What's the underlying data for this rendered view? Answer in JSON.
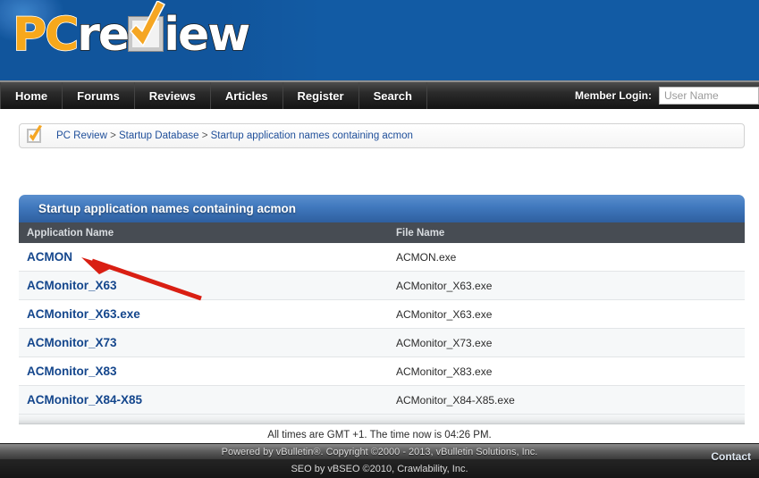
{
  "site": {
    "logo": {
      "part1": "PC",
      "part2": "re",
      "part3": "iew",
      "icon": "checkbox-check-icon"
    }
  },
  "nav": {
    "items": [
      {
        "label": "Home"
      },
      {
        "label": "Forums"
      },
      {
        "label": "Reviews"
      },
      {
        "label": "Articles"
      },
      {
        "label": "Register"
      },
      {
        "label": "Search"
      }
    ],
    "login_label": "Member Login:",
    "username_placeholder": "User Name",
    "username_value": ""
  },
  "breadcrumb": {
    "icon": "checkbox-check-icon",
    "root": "PC Review",
    "sep1": " > ",
    "level2": "Startup Database",
    "sep2": " > ",
    "current": "Startup application names containing acmon"
  },
  "panel": {
    "title": "Startup application names containing acmon",
    "columns": {
      "app": "Application Name",
      "file": "File Name"
    },
    "rows": [
      {
        "app": "ACMON",
        "file": "ACMON.exe"
      },
      {
        "app": "ACMonitor_X63",
        "file": "ACMonitor_X63.exe"
      },
      {
        "app": "ACMonitor_X63.exe",
        "file": "ACMonitor_X63.exe"
      },
      {
        "app": "ACMonitor_X73",
        "file": "ACMonitor_X73.exe"
      },
      {
        "app": "ACMonitor_X83",
        "file": "ACMonitor_X83.exe"
      },
      {
        "app": "ACMonitor_X84-X85",
        "file": "ACMonitor_X84-X85.exe"
      }
    ]
  },
  "annotation": {
    "type": "red-arrow",
    "color": "#d91f13",
    "points_to_row": "ACMON"
  },
  "footer": {
    "times": "All times are GMT +1. The time now is 04:26 PM.",
    "powered": "Powered by vBulletin®. Copyright ©2000 - 2013, vBulletin Solutions, Inc.",
    "seo": "SEO by vBSEO ©2010, Crawlability, Inc.",
    "contact": "Contact"
  },
  "colors": {
    "header_blue": "#125ba4",
    "panel_blue": "#4078bd",
    "link_blue": "#14468c",
    "breadcrumb_blue": "#1f4f9a",
    "header_row": "#474c53",
    "logo_orange": "#f7a81b",
    "arrow_red": "#d91f13"
  }
}
